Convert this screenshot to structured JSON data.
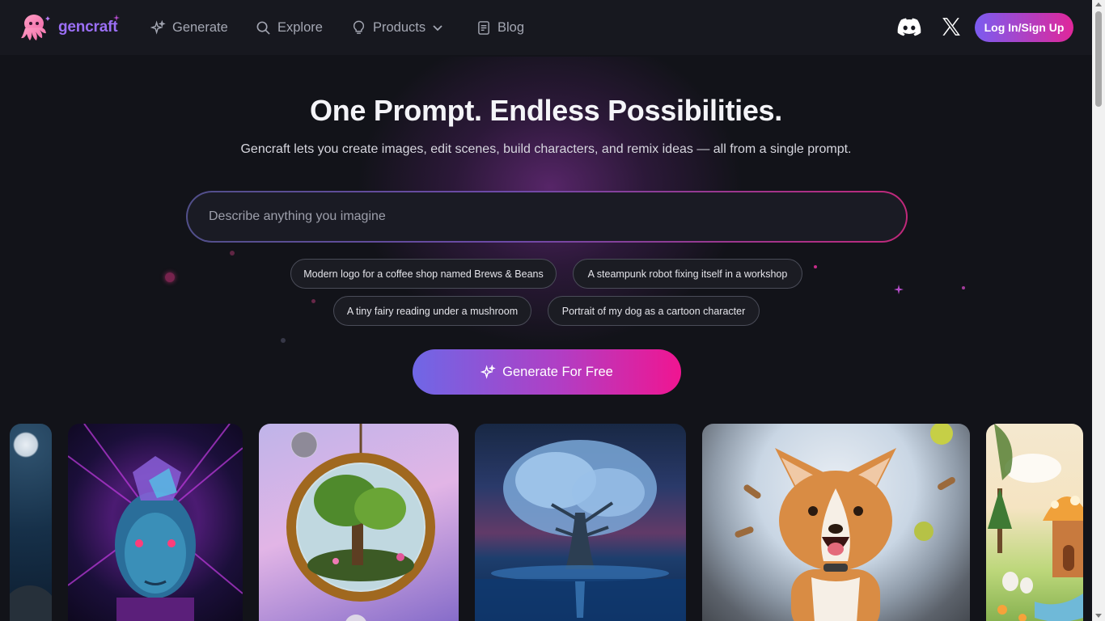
{
  "brand": {
    "name": "gencraft"
  },
  "nav": {
    "items": [
      {
        "label": "Generate",
        "icon": "sparkle-icon"
      },
      {
        "label": "Explore",
        "icon": "search-icon"
      },
      {
        "label": "Products",
        "icon": "lightbulb-icon"
      },
      {
        "label": "Blog",
        "icon": "document-icon"
      }
    ],
    "login_label": "Log In/Sign Up"
  },
  "hero": {
    "title": "One Prompt. Endless Possibilities.",
    "subtitle": "Gencraft lets you create images, edit scenes, build characters, and remix ideas — all from a single prompt.",
    "prompt_placeholder": "Describe anything you imagine",
    "suggestions": [
      "Modern logo for a coffee shop named Brews & Beans",
      "A steampunk robot fixing itself in a workshop",
      "A tiny fairy reading under a mushroom",
      "Portrait of my dog as a cartoon character"
    ],
    "generate_label": "Generate For Free"
  },
  "gallery": [
    {
      "subject": "moon-night"
    },
    {
      "subject": "cyber-face"
    },
    {
      "subject": "terrarium-orb"
    },
    {
      "subject": "glowing-tree"
    },
    {
      "subject": "corgi-portal"
    },
    {
      "subject": "mushroom-house"
    }
  ],
  "colors": {
    "background": "#121319",
    "nav_bg": "#17181f",
    "accent_purple": "#7b5cf0",
    "accent_pink": "#e0279a"
  }
}
